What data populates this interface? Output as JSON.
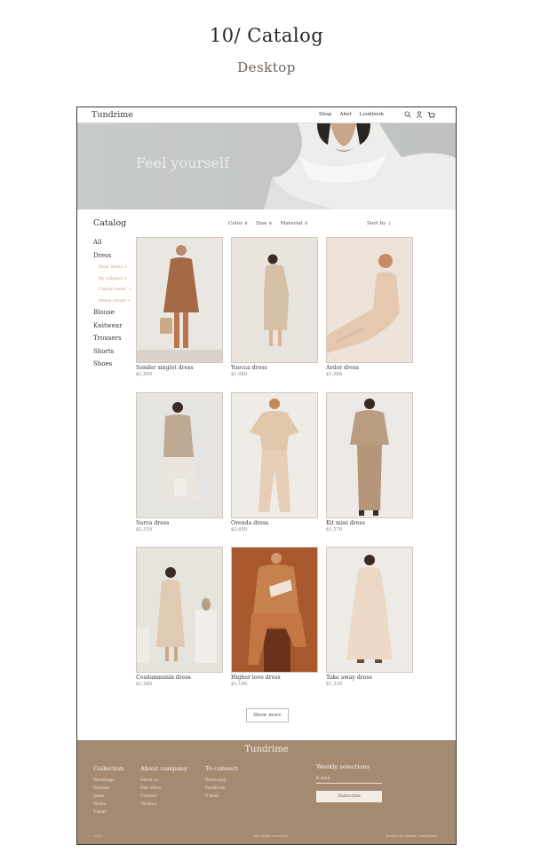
{
  "heading": {
    "title": "10/ Catalog",
    "subtitle": "Desktop"
  },
  "nav": {
    "logo": "Tundrime",
    "links": [
      "Shop",
      "Abot",
      "Lookbook"
    ],
    "icons": [
      "search-icon",
      "user-icon",
      "cart-icon"
    ],
    "cart_count": "0"
  },
  "hero": {
    "text": "Feel yourself"
  },
  "catalog": {
    "title": "Catalog",
    "filters": [
      "Color ∨",
      "Size ∨",
      "Material ∨"
    ],
    "sort": "Sort by ⇣"
  },
  "sidebar": {
    "items": [
      "All",
      "Dress",
      "Blouse",
      "Knitwear",
      "Trousers",
      "Shorts",
      "Shoes"
    ],
    "dress_sub": [
      "New items +",
      "By subject +",
      "Casual wear +",
      "Dress candy +"
    ]
  },
  "products": [
    {
      "name": "Sonder singlet dress",
      "price": "$1,809"
    },
    {
      "name": "Yuecca dress",
      "price": "$1,080"
    },
    {
      "name": "Ardor dress",
      "price": "$1,089"
    },
    {
      "name": "Surva dress",
      "price": "$2,539"
    },
    {
      "name": "Orenda dress",
      "price": "$2,650"
    },
    {
      "name": "Kit mini dress",
      "price": "$1,570"
    },
    {
      "name": "Cosdamminin dress",
      "price": "$1,589"
    },
    {
      "name": "Higher love dress",
      "price": "$1,100"
    },
    {
      "name": "Take away dress",
      "price": "$1,539"
    }
  ],
  "show_more": "Show more",
  "footer": {
    "logo": "Tundrime",
    "collection": {
      "title": "Collection",
      "links": [
        "Handbags",
        "Dresses",
        "Jeans",
        "Shoes",
        "T-shirt"
      ]
    },
    "about": {
      "title": "About company",
      "links": [
        "About us",
        "Our office",
        "Contact",
        "Vacancy"
      ]
    },
    "connect": {
      "title": "To connect",
      "links": [
        "WhatsApp",
        "Facebook",
        "E-mail"
      ]
    },
    "weekly": {
      "title": "Weekly selections",
      "email_placeholder": "E-mail",
      "button": "Subscribe"
    },
    "small_left": "2022",
    "rights": "All rights reserved",
    "credit": "Design by Albina Lolalokyan"
  },
  "colors": {
    "accent": "#a58a72",
    "sub_link": "#c09b7e"
  }
}
